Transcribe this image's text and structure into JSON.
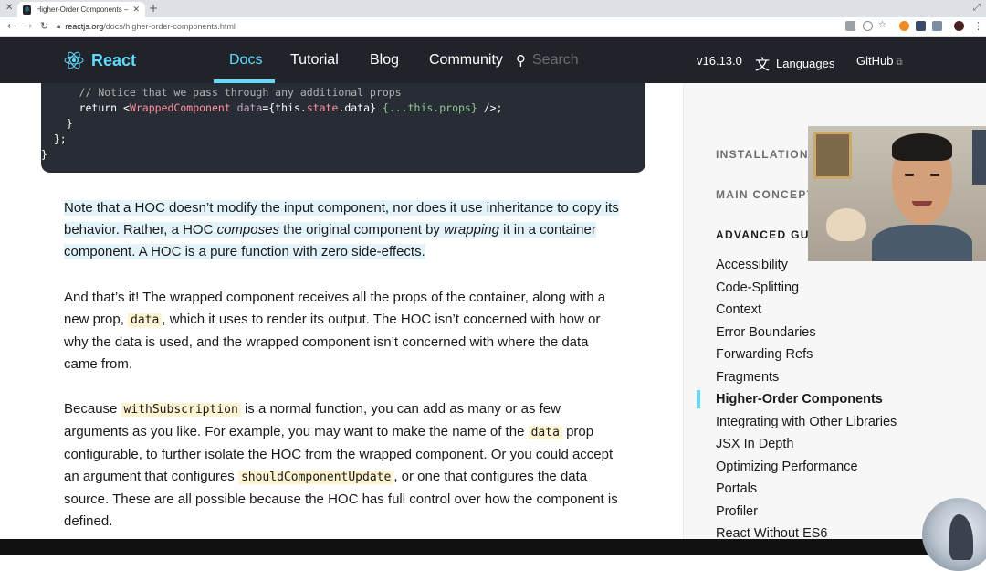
{
  "browser": {
    "tab_title": "Higher-Order Components – Re",
    "url_host": "reactjs.org",
    "url_path": "/docs/higher-order-components.html"
  },
  "header": {
    "logo_text": "React",
    "nav": [
      "Docs",
      "Tutorial",
      "Blog",
      "Community"
    ],
    "active_nav": "Docs",
    "search_placeholder": "Search",
    "version": "v16.13.0",
    "languages_label": "Languages",
    "github_label": "GitHub"
  },
  "code": {
    "line1_comment": "// Notice that we pass through any additional props",
    "line2_return": "return ",
    "line2_tag_open": "<",
    "line2_tag": "WrappedComponent",
    "line2_attr": " data",
    "line2_expr1": "={this.",
    "line2_state": "state",
    "line2_expr2": ".data}",
    "line2_spread": " {...this.props}",
    "line2_close": " />;",
    "line3": "    }",
    "line4": "  };",
    "line5": "}"
  },
  "article": {
    "p1_a": "Note that a HOC doesn’t modify the input component, nor does it use inheritance to copy its behavior. Rather, a HOC ",
    "p1_em1": "composes",
    "p1_b": " the original component by ",
    "p1_em2": "wrapping",
    "p1_c": " it in a container component. A HOC is a pure function with zero side-effects.",
    "p2_a": "And that’s it! The wrapped component receives all the props of the container, along with a new prop, ",
    "p2_code": "data",
    "p2_b": ", which it uses to render its output. The HOC isn’t concerned with how or why the data is used, and the wrapped component isn’t concerned with where the data came from.",
    "p3_a": "Because ",
    "p3_code1": "withSubscription",
    "p3_b": " is a normal function, you can add as many or as few arguments as you like. For example, you may want to make the name of the ",
    "p3_code2": "data",
    "p3_c": " prop configurable, to further isolate the HOC from the wrapped component. Or you could accept an argument that configures ",
    "p3_code3": "shouldComponentUpdate",
    "p3_d": ", or one that configures the data source. These are all possible because the HOC has full control over how the component is defined."
  },
  "sidebar": {
    "headings": [
      "INSTALLATION",
      "MAIN CONCEPTS",
      "ADVANCED GUIDES"
    ],
    "items": [
      "Accessibility",
      "Code-Splitting",
      "Context",
      "Error Boundaries",
      "Forwarding Refs",
      "Fragments",
      "Higher-Order Components",
      "Integrating with Other Libraries",
      "JSX In Depth",
      "Optimizing Performance",
      "Portals",
      "Profiler",
      "React Without ES6"
    ],
    "active_item": "Higher-Order Components"
  },
  "colors": {
    "header_bg": "#20232a",
    "accent": "#61dafb",
    "code_bg": "#282c34",
    "highlight": "#e3f3fa",
    "inline_code_bg": "#fff4d2"
  }
}
